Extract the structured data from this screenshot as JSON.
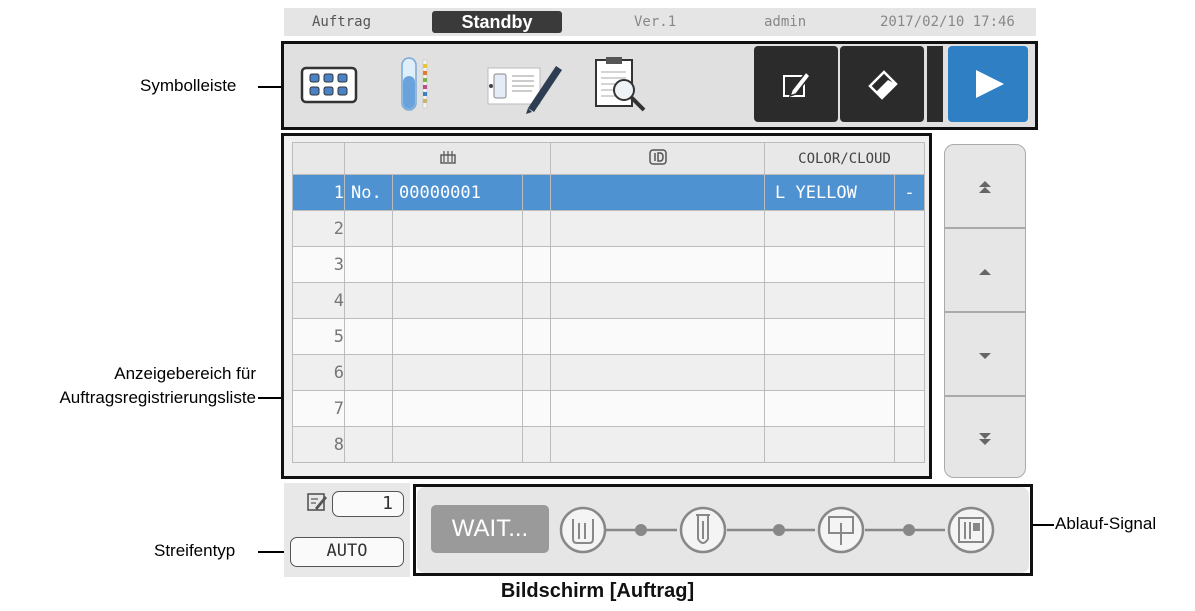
{
  "status_bar": {
    "screen": "Auftrag",
    "state": "Standby",
    "version": "Ver.1",
    "user": "admin",
    "datetime": "2017/02/10 17:46"
  },
  "table": {
    "headers": [
      "",
      "",
      "",
      "COLOR/CLOUD"
    ],
    "rows": [
      {
        "num": "1",
        "rack": "No.",
        "id": "00000001",
        "color": "L YELLOW",
        "extra": "-"
      },
      {
        "num": "2",
        "rack": "",
        "id": "",
        "color": "",
        "extra": ""
      },
      {
        "num": "3",
        "rack": "",
        "id": "",
        "color": "",
        "extra": ""
      },
      {
        "num": "4",
        "rack": "",
        "id": "",
        "color": "",
        "extra": ""
      },
      {
        "num": "5",
        "rack": "",
        "id": "",
        "color": "",
        "extra": ""
      },
      {
        "num": "6",
        "rack": "",
        "id": "",
        "color": "",
        "extra": ""
      },
      {
        "num": "7",
        "rack": "",
        "id": "",
        "color": "",
        "extra": ""
      },
      {
        "num": "8",
        "rack": "",
        "id": "",
        "color": "",
        "extra": ""
      }
    ]
  },
  "strip": {
    "count": "1",
    "mode": "AUTO"
  },
  "flow": {
    "wait_label": "WAIT..."
  },
  "callouts": {
    "toolbar": "Symbolleiste",
    "list_line1": "Anzeigebereich für",
    "list_line2": "Auftragsregistrierungsliste",
    "strip_type": "Streifentyp",
    "flow_signal": "Ablauf-Signal"
  },
  "caption": "Bildschirm [Auftrag]",
  "colors": {
    "accent": "#2f7fc5",
    "selected_row": "#4f92d2",
    "dark_button": "#2b2b2b"
  }
}
